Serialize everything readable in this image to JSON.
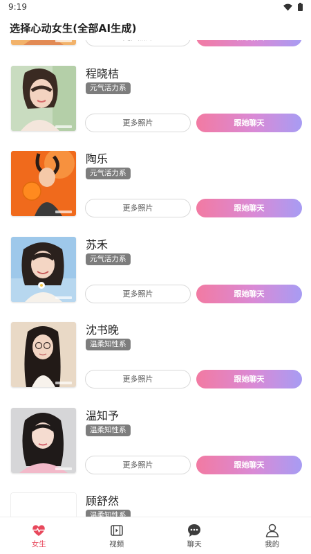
{
  "status_bar": {
    "time": "9:19"
  },
  "header": {
    "title": "选择心动女生(全部AI生成)"
  },
  "buttons": {
    "more_photos": "更多照片",
    "chat": "跟她聊天"
  },
  "profiles": [
    {
      "name": "",
      "tag": "",
      "photo": "orange-bg"
    },
    {
      "name": "程晓桔",
      "tag": "元气活力系",
      "photo": "green-bg"
    },
    {
      "name": "陶乐",
      "tag": "元气活力系",
      "photo": "orange-splash"
    },
    {
      "name": "苏禾",
      "tag": "元气活力系",
      "photo": "sky-blue"
    },
    {
      "name": "沈书晚",
      "tag": "温柔知性系",
      "photo": "beige"
    },
    {
      "name": "温知予",
      "tag": "温柔知性系",
      "photo": "grey-studio"
    },
    {
      "name": "顾舒然",
      "tag": "温柔知性系",
      "photo": "white"
    }
  ],
  "tabbar": {
    "active": "girls",
    "items": [
      {
        "key": "girls",
        "label": "女生",
        "icon": "heart-pulse-icon"
      },
      {
        "key": "video",
        "label": "视频",
        "icon": "video-icon"
      },
      {
        "key": "chat",
        "label": "聊天",
        "icon": "chat-bubble-icon"
      },
      {
        "key": "mine",
        "label": "我的",
        "icon": "user-icon"
      }
    ]
  },
  "colors": {
    "accent_red": "#e8485c",
    "chat_gradient_start": "#f27aa2",
    "chat_gradient_end": "#a79cf3",
    "tag_bg": "#7d7d7d"
  }
}
